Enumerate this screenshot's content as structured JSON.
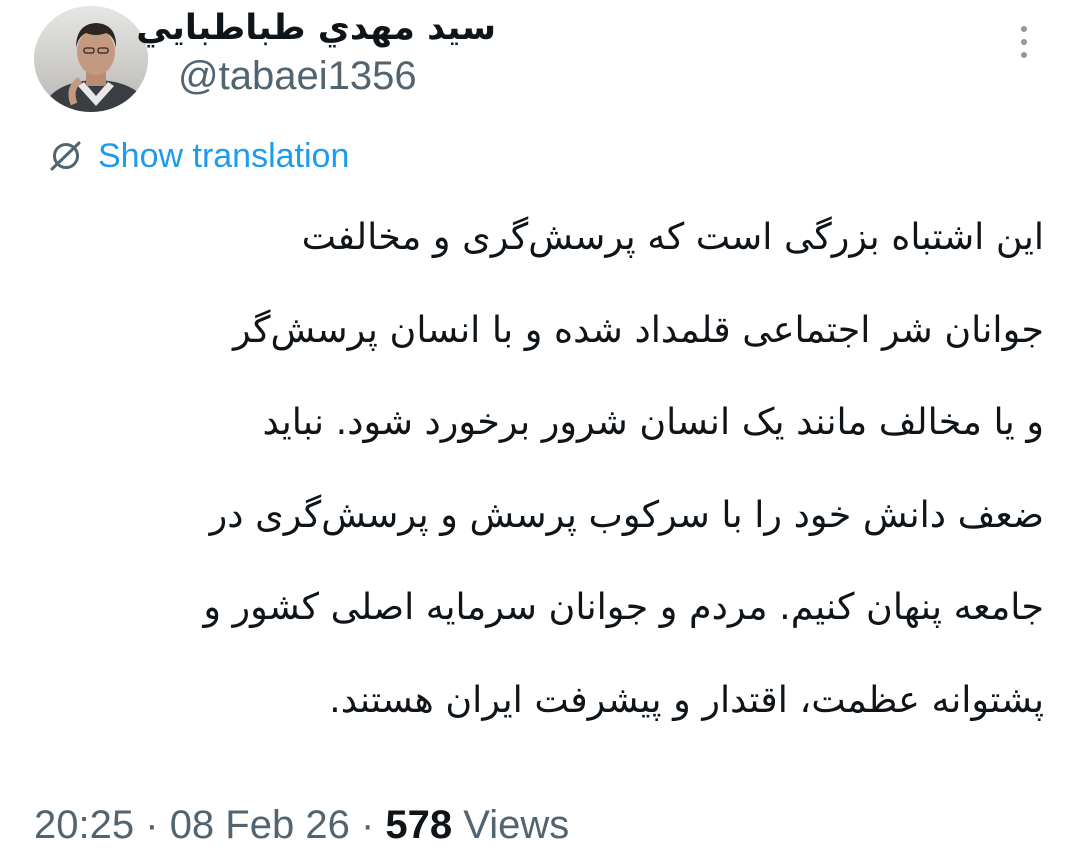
{
  "author": {
    "display_name": "سيد مهدي طباطبايي",
    "handle": "@tabaei1356"
  },
  "translate": {
    "label": "Show translation"
  },
  "tweet": {
    "lines": [
      "این اشتباه بزرگی است که پرسش‌گری و مخالفت",
      "جوانان شر اجتماعی قلمداد شده و با انسان پرسش‌گر",
      "و یا مخالف مانند یک انسان شرور برخورد شود. نباید",
      "ضعف دانش خود را با سرکوب پرسش و پرسش‌گری در",
      "جامعه پنهان کنیم. مردم و جوانان سرمایه اصلی کشور و",
      "پشتوانه عظمت، اقتدار و پیشرفت ایران هستند."
    ]
  },
  "meta": {
    "time": "20:25",
    "separator": "·",
    "date": "08 Feb 26",
    "views_count": "578",
    "views_label": "Views"
  },
  "colors": {
    "text_primary": "#0f1419",
    "text_secondary": "#536471",
    "link_accent": "#1d9bf0"
  },
  "icons": {
    "more": "more-vertical-icon",
    "translate": "translate-globe-icon"
  }
}
